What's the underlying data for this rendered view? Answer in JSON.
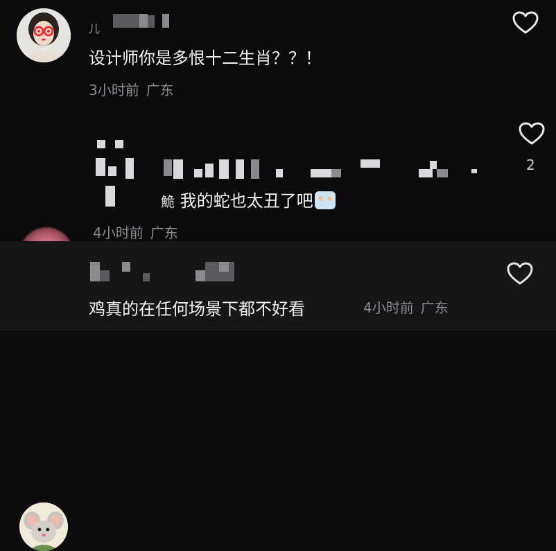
{
  "comments": [
    {
      "username_visible": "儿",
      "text": "设计师你是多恨十二生肖？？！",
      "time": "3小时前",
      "location": "广东",
      "like_count": "",
      "like_icon": "heart-outline-icon"
    },
    {
      "username_visible": "",
      "text_prefix": "鮠",
      "text": "我的蛇也太丑了吧",
      "emoji": "crying-face-sticker",
      "time": "4小时前",
      "location": "广东",
      "like_count": "2",
      "like_icon": "heart-outline-icon"
    },
    {
      "username_visible": "",
      "text": "鸡真的在任何场景下都不好看",
      "time": "4小时前",
      "location": "广东",
      "like_count": "",
      "like_icon": "heart-outline-icon"
    }
  ],
  "colors": {
    "background": "#0c0c0e",
    "highlight_row": "#161618",
    "text": "#f2f2f2",
    "meta": "#8a8a90"
  }
}
